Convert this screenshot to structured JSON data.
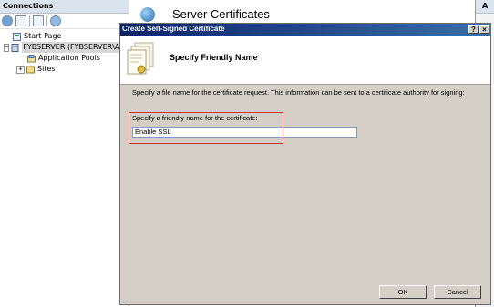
{
  "connections": {
    "header": "Connections",
    "tree": [
      {
        "label": "Start Page"
      },
      {
        "label": "FYBSERVER (FYBSERVER\\Adm",
        "toggle": "−"
      },
      {
        "label": "Application Pools"
      },
      {
        "label": "Sites",
        "toggle": "+"
      }
    ]
  },
  "main": {
    "title": "Server Certificates"
  },
  "actions": {
    "header": "A"
  },
  "dialog": {
    "title": "Create Self-Signed Certificate",
    "help_glyph": "?",
    "close_glyph": "×",
    "heading": "Specify Friendly Name",
    "description": "Specify a file name for the certificate request.  This information can be sent to a certificate authority for signing:",
    "field_label": "Specify a friendly name for the certificate:",
    "field_value": "Enable SSL",
    "ok_label": "OK",
    "cancel_label": "Cancel"
  },
  "icons": [
    "start-page-icon",
    "server-icon",
    "app-pools-icon",
    "sites-icon",
    "certificate-icon",
    "globe-icon"
  ],
  "colors": {
    "titlebar": "#0a246a",
    "dialog_bg": "#d4d0c8",
    "highlight": "#d03030"
  }
}
